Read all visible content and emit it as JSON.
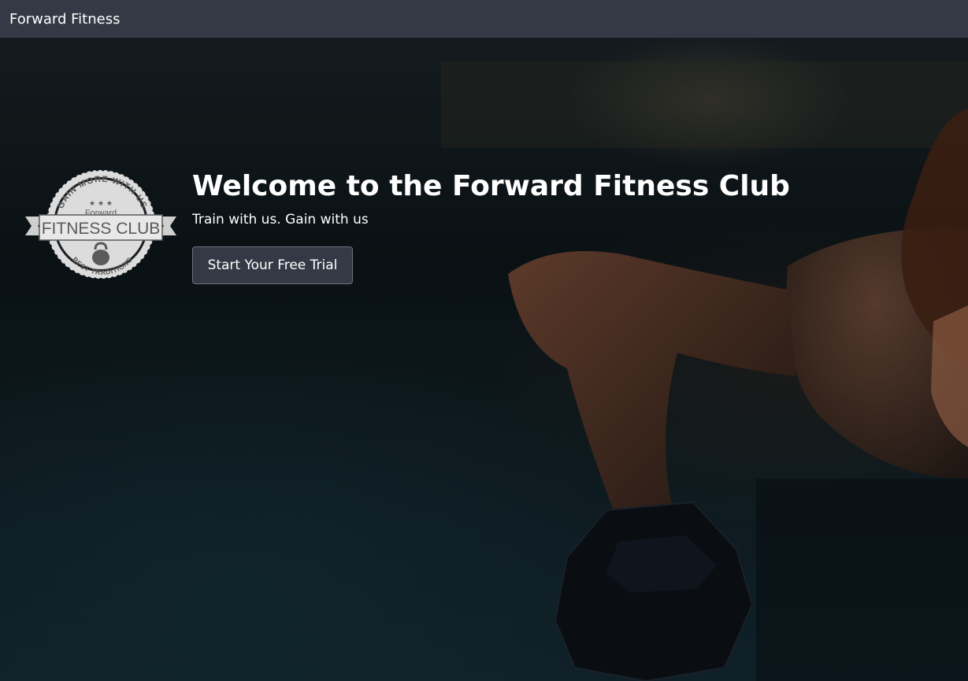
{
  "navbar": {
    "brand": "Forward Fitness"
  },
  "hero": {
    "title": "Welcome to the Forward Fitness Club",
    "subtitle": "Train with us. Gain with us",
    "cta_label": "Start Your Free Trial"
  },
  "logo": {
    "top_arc": "GAIN MORE WITH US",
    "small": "Forward",
    "main": "FITNESS CLUB",
    "bottom_arc": "BEST TRADITIONS"
  },
  "colors": {
    "navbar_bg": "#343a45",
    "text": "#ffffff",
    "logo": "#dcdcdc"
  }
}
